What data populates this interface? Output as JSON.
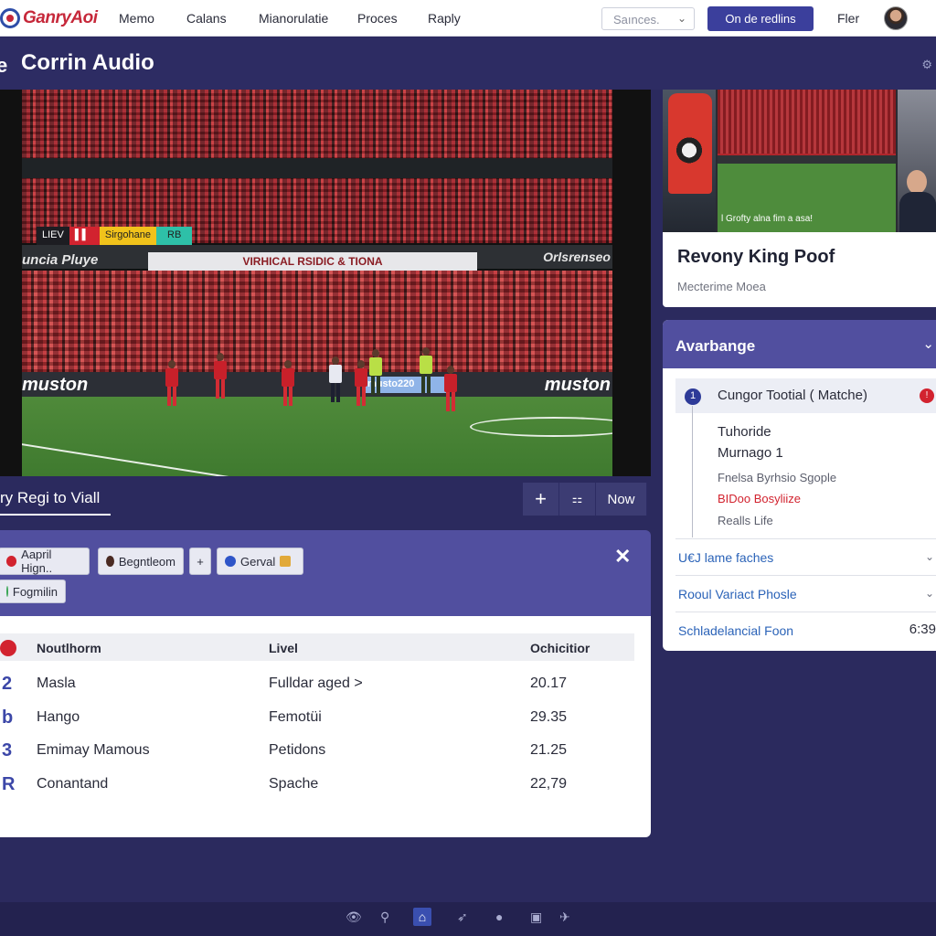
{
  "nav": {
    "logo": "GanryAoi",
    "links": [
      "Memo",
      "Calans",
      "Mianorulatie",
      "Proces",
      "Raply"
    ],
    "search_placeholder": "Saınces.",
    "cta": "On de redlins",
    "fler": "Fler"
  },
  "app": {
    "title": "Corrin Audio"
  },
  "video": {
    "tags": {
      "live": "LIEV",
      "yellow": "Sirgohane",
      "teal": "RB"
    },
    "board_left": "uncia Pluye",
    "board_mid": "VIRHICAL RSIDIC & TIONA",
    "board_right": "Orlsrenseo",
    "ad_left": "muston",
    "ad_mid": "musto220",
    "ad_right": "muston"
  },
  "subnav": {
    "title": "ry Regi to Viall",
    "now": "Now"
  },
  "filters": [
    "Aapril Hign..",
    "Begntleom",
    "Gerval",
    "Fogmilin"
  ],
  "table": {
    "headers": [
      "Noutlhorm",
      "Livel",
      "Ochicitior"
    ],
    "rows": [
      {
        "num": "2",
        "name": "Masla",
        "live": "Fulldar aged >",
        "val": "20.17"
      },
      {
        "num": "b",
        "name": "Hango",
        "live": "Femotüi",
        "val": "29.35"
      },
      {
        "num": "3",
        "name": "Emimay Mamous",
        "live": "Petidons",
        "val": "21.25"
      },
      {
        "num": "R",
        "name": "Conantand",
        "live": "Spache",
        "val": "22,79"
      }
    ]
  },
  "thumb": {
    "caption": "l Grofty alna fim a asa!",
    "title": "Revony King Poof",
    "subtitle": "Mecterime Moea"
  },
  "accordion": {
    "title": "Avarbange",
    "match_num": "1",
    "match_label": "Cungor Tootial ( Matche)",
    "timeline": [
      "Tuhoride",
      "Murnago 1",
      "Fnelsa Byrhsio Sgople",
      "BIDoo Bosyliize",
      "Realls Life"
    ],
    "rows": [
      "U€J lame faches",
      "Rooul Variact Phosle",
      "Schladelancial Foon"
    ],
    "time": "6:39"
  }
}
